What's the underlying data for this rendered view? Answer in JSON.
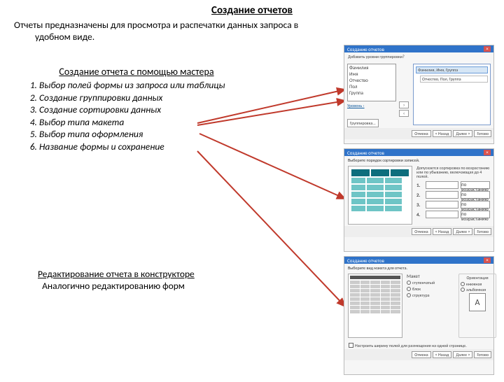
{
  "title": "Создание отчетов",
  "intro_line": "Отчеты предназначены для просмотра и распечатки данных запроса в",
  "intro_line2": "удобном виде.",
  "subtitle": "Создание отчета с помощью мастера",
  "steps": [
    "Выбор полей формы из запроса или таблицы",
    "Создание группировки данных",
    "Создание сортировки данных",
    "Выбор типа макета",
    "Выбор типа оформления",
    "Название формы и сохранение"
  ],
  "footer1": "Редактирование отчета в конструкторе",
  "footer2": "Аналогично редактированию форм",
  "wizard_caption": "Создание отчетов",
  "buttons": {
    "cancel": "Отмена",
    "back": "< Назад",
    "next": "Далее >",
    "finish": "Готово"
  },
  "p1": {
    "prompt": "Добавить уровни группировки?",
    "left_items": [
      "Фамилия",
      "Имя",
      "Отчество",
      "Пол",
      "Группа"
    ],
    "sel": "Фамилия, Имя, Группа",
    "sel2": "Отчество, Пол, Группа",
    "levels": "Уровень ›",
    "grp": "Группировка..."
  },
  "p2": {
    "hint": "Выберите порядок сортировки записей.",
    "note": "Допускается сортировка по возрастанию или по убыванию, включающая до 4 полей.",
    "labels": [
      "1.",
      "2.",
      "3.",
      "4."
    ],
    "asc": "по возрастанию"
  },
  "p3": {
    "hint": "Выберите вид макета для отчета.",
    "layout_h": "Макет",
    "layouts": [
      "ступенчатый",
      "блок",
      "структура"
    ],
    "orient_h": "Ориентация",
    "orients": [
      "книжная",
      "альбомная"
    ],
    "orient_icon": "A",
    "chk": "Настроить ширину полей для размещения на одной странице."
  }
}
